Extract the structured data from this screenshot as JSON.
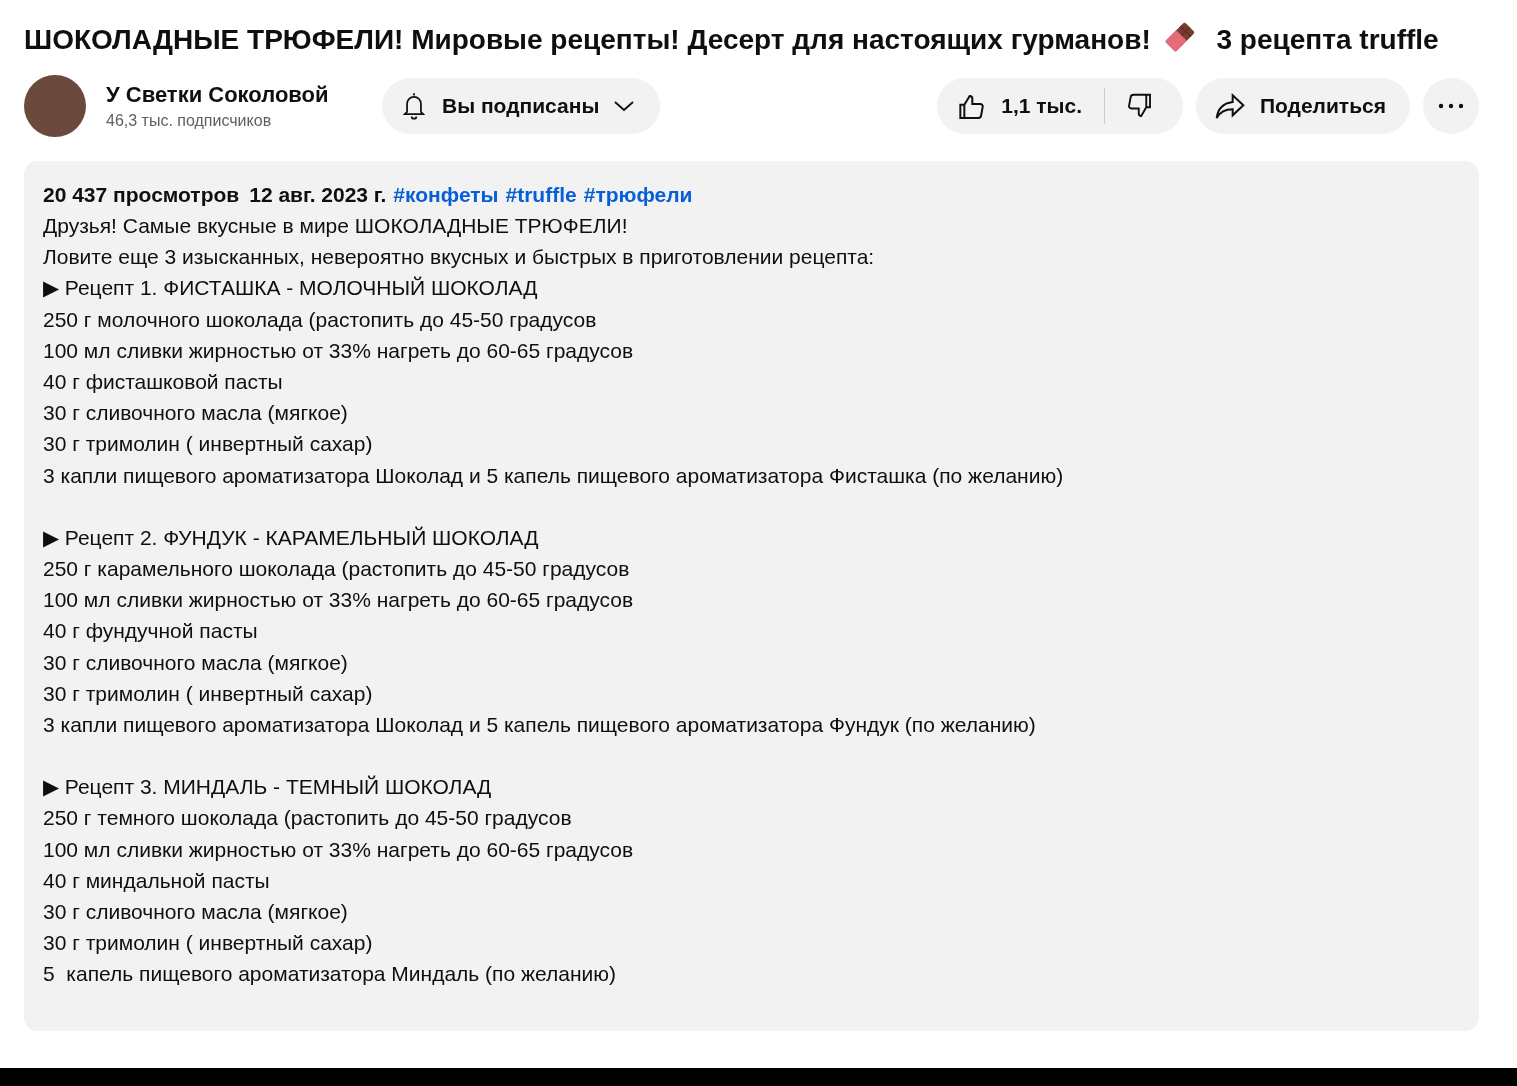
{
  "video": {
    "title_start": "ШОКОЛАДНЫЕ ТРЮФЕЛИ! Мировые рецепты! Десерт для настоящих гурманов!",
    "title_end": [
      "3 рецепта",
      "truffle"
    ]
  },
  "channel": {
    "name": "У Светки Соколовой",
    "subscribers": "46,3 тыс. подписчиков",
    "subscribe_button": "Вы подписаны"
  },
  "actions": {
    "likes": "1,1 тыс.",
    "share": "Поделиться"
  },
  "description": {
    "views": "20 437 просмотров",
    "date": "12 авг. 2023 г.",
    "hashtags": [
      "#конфеты",
      "#truffle",
      "#трюфели"
    ],
    "blocks": [
      [
        "Друзья! Самые вкусные в мире ШОКОЛАДНЫЕ ТРЮФЕЛИ!",
        "Ловите еще 3 изысканных, невероятно вкусных и быстрых в приготовлении рецепта:",
        "▶ Рецепт 1. ФИСТАШКА - МОЛОЧНЫЙ ШОКОЛАД",
        "250 г молочного шоколада (растопить до 45-50 градусов",
        "100 мл сливки жирностью от 33% нагреть до 60-65 градусов",
        "40 г фисташковой пасты",
        "30 г сливочного масла (мягкое)",
        "30 г тримолин ( инвертный сахар)",
        "3 капли пищевого ароматизатора Шоколад и 5 капель пищевого ароматизатора Фисташка (по желанию)"
      ],
      [
        "▶ Рецепт 2. ФУНДУК - КАРАМЕЛЬНЫЙ ШОКОЛАД",
        "250 г карамельного шоколада (растопить до 45-50 градусов",
        "100 мл сливки жирностью от 33% нагреть до 60-65 градусов",
        "40 г фундучной пасты",
        "30 г сливочного масла (мягкое)",
        "30 г тримолин ( инвертный сахар)",
        "3 капли пищевого ароматизатора Шоколад и 5 капель пищевого ароматизатора Фундук (по желанию)"
      ],
      [
        "▶ Рецепт 3. МИНДАЛЬ - ТЕМНЫЙ ШОКОЛАД",
        "250 г темного шоколада (растопить до 45-50 градусов",
        "100 мл сливки жирностью от 33% нагреть до 60-65 градусов",
        "40 г миндальной пасты",
        "30 г сливочного масла (мягкое)",
        "30 г тримолин ( инвертный сахар)",
        "5  капель пищевого ароматизатора Миндаль (по желанию)"
      ]
    ]
  }
}
